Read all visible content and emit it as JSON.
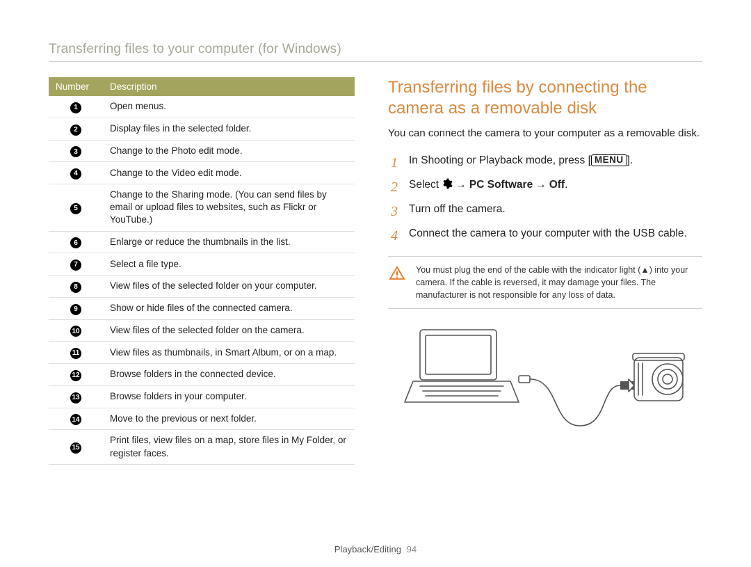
{
  "topic_title": "Transferring files to your computer (for Windows)",
  "table": {
    "header": {
      "number": "Number",
      "desc": "Description"
    },
    "rows": [
      {
        "n": "1",
        "desc": "Open menus."
      },
      {
        "n": "2",
        "desc": "Display files in the selected folder."
      },
      {
        "n": "3",
        "desc": "Change to the Photo edit mode."
      },
      {
        "n": "4",
        "desc": "Change to the Video edit mode."
      },
      {
        "n": "5",
        "desc": "Change to the Sharing mode. (You can send files by email or upload files to websites, such as Flickr or YouTube.)"
      },
      {
        "n": "6",
        "desc": "Enlarge or reduce the thumbnails in the list."
      },
      {
        "n": "7",
        "desc": "Select a file type."
      },
      {
        "n": "8",
        "desc": "View files of the selected folder on your computer."
      },
      {
        "n": "9",
        "desc": "Show or hide files of the connected camera."
      },
      {
        "n": "10",
        "desc": "View files of the selected folder on the camera."
      },
      {
        "n": "11",
        "desc": "View files as thumbnails, in Smart Album, or on a map."
      },
      {
        "n": "12",
        "desc": "Browse folders in the connected device."
      },
      {
        "n": "13",
        "desc": "Browse folders in your computer."
      },
      {
        "n": "14",
        "desc": "Move to the previous or next folder."
      },
      {
        "n": "15",
        "desc": "Print files, view files on a map, store files in My Folder, or register faces."
      }
    ]
  },
  "section_heading": "Transferring files by connecting the camera as a removable disk",
  "lead": "You can connect the camera to your computer as a removable disk.",
  "steps": [
    {
      "n": "1",
      "pre": "In Shooting or Playback mode, press [",
      "button": "MENU",
      "post": "]."
    },
    {
      "n": "2",
      "pre": "Select ",
      "icon": "gear",
      "arrow": "→",
      "b1": "PC Software",
      "arrow2": "→",
      "b2": "Off",
      "post": "."
    },
    {
      "n": "3",
      "text": "Turn off the camera."
    },
    {
      "n": "4",
      "text": "Connect the camera to your computer with the USB cable."
    }
  ],
  "note": "You must plug the end of the cable with the indicator light (▲) into your camera. If the cable is reversed, it may damage your files. The manufacturer is not responsible for any loss of data.",
  "footer": {
    "section": "Playback/Editing",
    "page": "94"
  }
}
